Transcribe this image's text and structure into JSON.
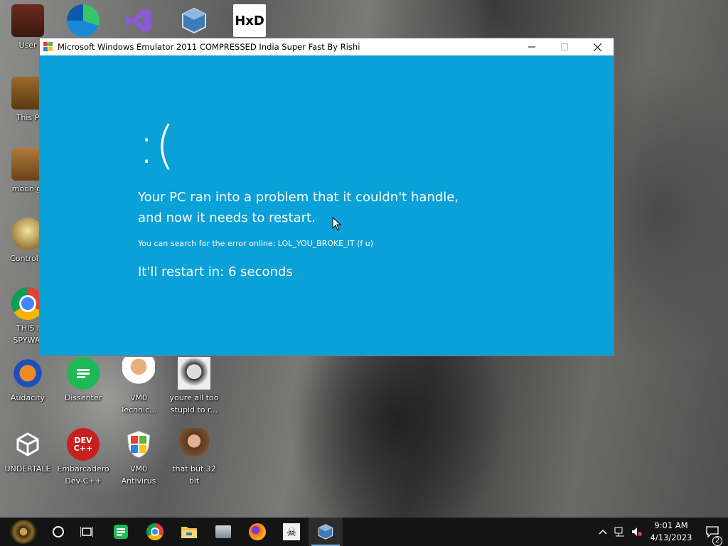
{
  "desktop": {
    "icons": [
      {
        "label": "User",
        "icon": "user-folder-icon"
      },
      {
        "label": "This P",
        "icon": "this-pc-icon"
      },
      {
        "label": "moon gi",
        "icon": "moon-icon"
      },
      {
        "label": "Control P",
        "icon": "control-panel-icon"
      },
      {
        "label": "THIS I\nSPYWAI",
        "icon": "chrome-icon"
      },
      {
        "label": "Audacity",
        "icon": "audacity-icon"
      },
      {
        "label": "Dissenter",
        "icon": "dissenter-icon"
      },
      {
        "label": "VM0\nTechnic...",
        "icon": "technician-icon"
      },
      {
        "label": "youre all too\nstupid to r...",
        "icon": "portrait-icon"
      },
      {
        "label": "UNDERTALE",
        "icon": "unity-icon"
      },
      {
        "label": "Embarcadero\nDev-C++",
        "icon": "devcpp-icon"
      },
      {
        "label": "VM0\nAntivirus",
        "icon": "shield-icon"
      },
      {
        "label": "that but 32\nbit",
        "icon": "portrait-icon"
      },
      {
        "label": "",
        "icon": "edge-icon"
      },
      {
        "label": "",
        "icon": "visual-studio-icon"
      },
      {
        "label": "",
        "icon": "virtualbox-icon"
      },
      {
        "label": "",
        "icon": "hxd-icon"
      }
    ]
  },
  "window": {
    "title": "Microsoft Windows Emulator 2011 COMPRESSED India Super Fast By Rishi",
    "bsod": {
      "face": ":(",
      "line1": "Your PC ran into a problem that it couldn't handle,",
      "line2": "and now it needs to restart.",
      "error_text": "You can search for the error online: LOL_YOU_BROKE_IT (f u)",
      "restart_text": "It'll restart in: 6 seconds"
    },
    "background_color": "#0aa0d8"
  },
  "taskbar": {
    "apps": [
      "start-icon",
      "search-icon",
      "task-view-icon",
      "spotify-icon",
      "chrome-icon",
      "file-explorer-icon",
      "app-icon",
      "firefox-icon",
      "skull-icon",
      "virtualbox-icon"
    ],
    "clock_time": "9:01 AM",
    "clock_date": "4/13/2023",
    "notification_count": "2"
  }
}
